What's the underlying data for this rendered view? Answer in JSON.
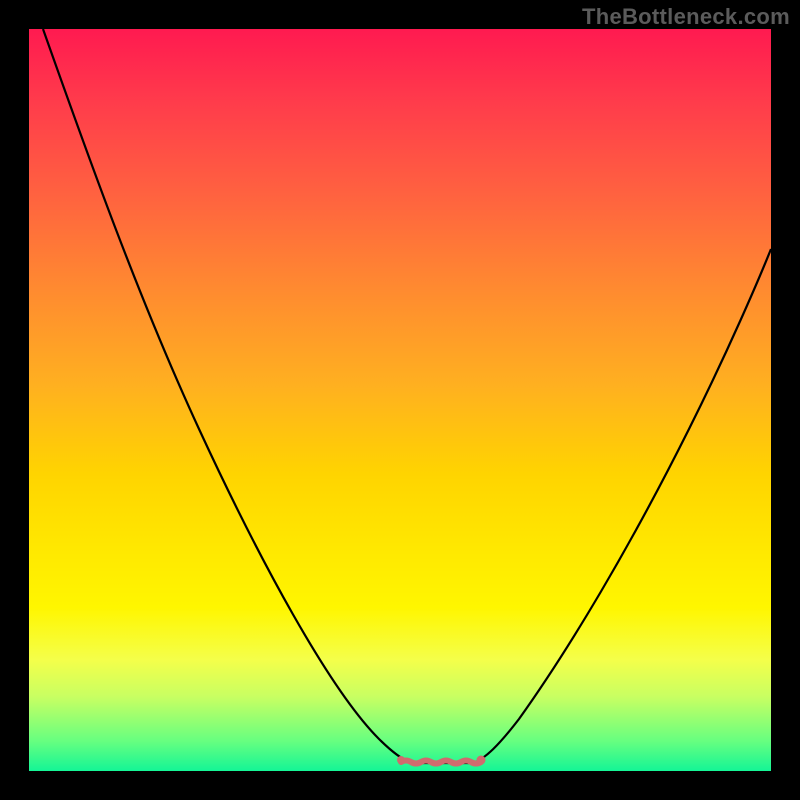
{
  "watermark": "TheBottleneck.com",
  "chart_data": {
    "type": "line",
    "title": "",
    "xlabel": "",
    "ylabel": "",
    "xlim": [
      0,
      100
    ],
    "ylim": [
      0,
      100
    ],
    "series": [
      {
        "name": "bottleneck-curve",
        "x": [
          2,
          6,
          10,
          14,
          18,
          22,
          26,
          30,
          34,
          38,
          42,
          46,
          48,
          50,
          52,
          54,
          56,
          58,
          60,
          64,
          68,
          72,
          76,
          80,
          84,
          88,
          92,
          96,
          100
        ],
        "y": [
          100,
          91,
          82,
          73,
          65,
          56,
          48,
          40,
          32,
          24,
          16,
          8,
          4,
          1.5,
          0.6,
          0.4,
          0.3,
          0.4,
          0.7,
          3,
          8,
          15,
          22,
          30,
          38,
          46,
          53,
          59,
          65
        ]
      }
    ],
    "flat_region": {
      "x_start": 50,
      "x_end": 60,
      "y": 0.6
    },
    "gradient_stops": [
      {
        "pct": 0,
        "color": "#ff1a50"
      },
      {
        "pct": 10,
        "color": "#ff3c4b"
      },
      {
        "pct": 22,
        "color": "#ff6140"
      },
      {
        "pct": 35,
        "color": "#ff8a30"
      },
      {
        "pct": 48,
        "color": "#ffb020"
      },
      {
        "pct": 60,
        "color": "#ffd400"
      },
      {
        "pct": 70,
        "color": "#ffe800"
      },
      {
        "pct": 78,
        "color": "#fff600"
      },
      {
        "pct": 85,
        "color": "#f4ff4a"
      },
      {
        "pct": 90,
        "color": "#c8ff62"
      },
      {
        "pct": 96,
        "color": "#66ff80"
      },
      {
        "pct": 100,
        "color": "#14f596"
      }
    ],
    "colors": {
      "background": "#000000",
      "curve": "#000000",
      "flat_highlight": "#d06a6e",
      "watermark": "#5b5b5b"
    }
  }
}
